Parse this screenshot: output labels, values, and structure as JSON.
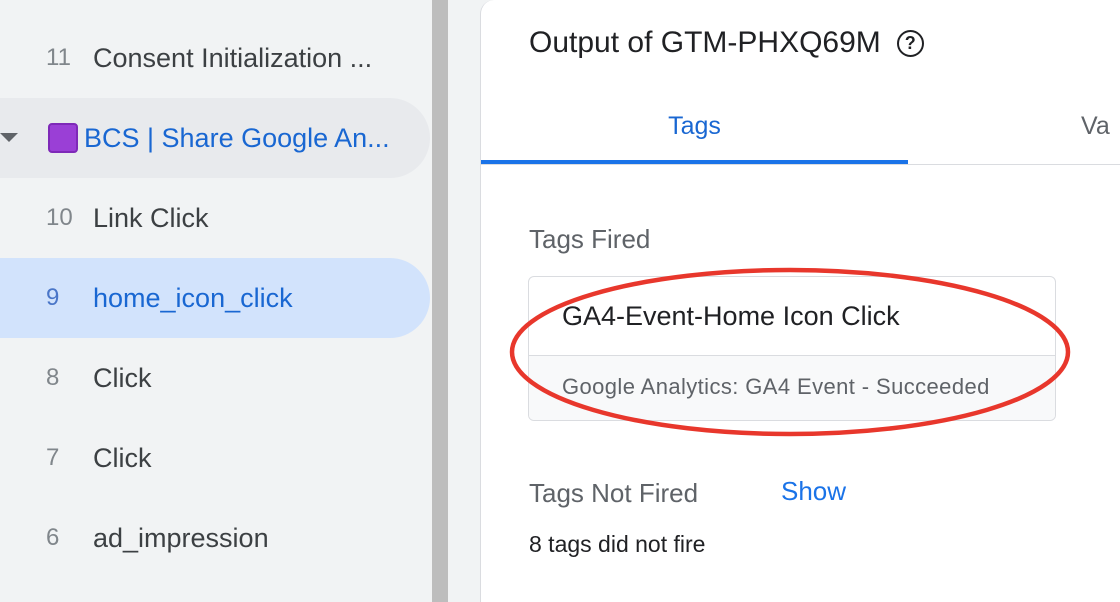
{
  "sidebar": {
    "items": [
      {
        "num": "11",
        "label": "Consent Initialization ..."
      },
      {
        "num": "",
        "label": "BCS | Share Google An...",
        "icon": "purple-square-icon"
      },
      {
        "num": "10",
        "label": "Link Click"
      },
      {
        "num": "9",
        "label": "home_icon_click"
      },
      {
        "num": "8",
        "label": "Click"
      },
      {
        "num": "7",
        "label": "Click"
      },
      {
        "num": "6",
        "label": "ad_impression"
      }
    ]
  },
  "panel": {
    "title": "Output of GTM-PHXQ69M",
    "tabs": [
      "Tags",
      "Va"
    ],
    "tags_fired_label": "Tags Fired",
    "fired_tag": {
      "name": "GA4-Event-Home Icon Click",
      "status": "Google Analytics: GA4 Event - Succeeded"
    },
    "tags_not_fired_label": "Tags Not Fired",
    "show_link": "Show",
    "not_fired_summary": "8 tags did not fire"
  },
  "colors": {
    "accent": "#1a73e8",
    "selected_bg": "#d2e3fc",
    "annotation": "#e8372c",
    "group_icon": "#9a3fd6"
  }
}
